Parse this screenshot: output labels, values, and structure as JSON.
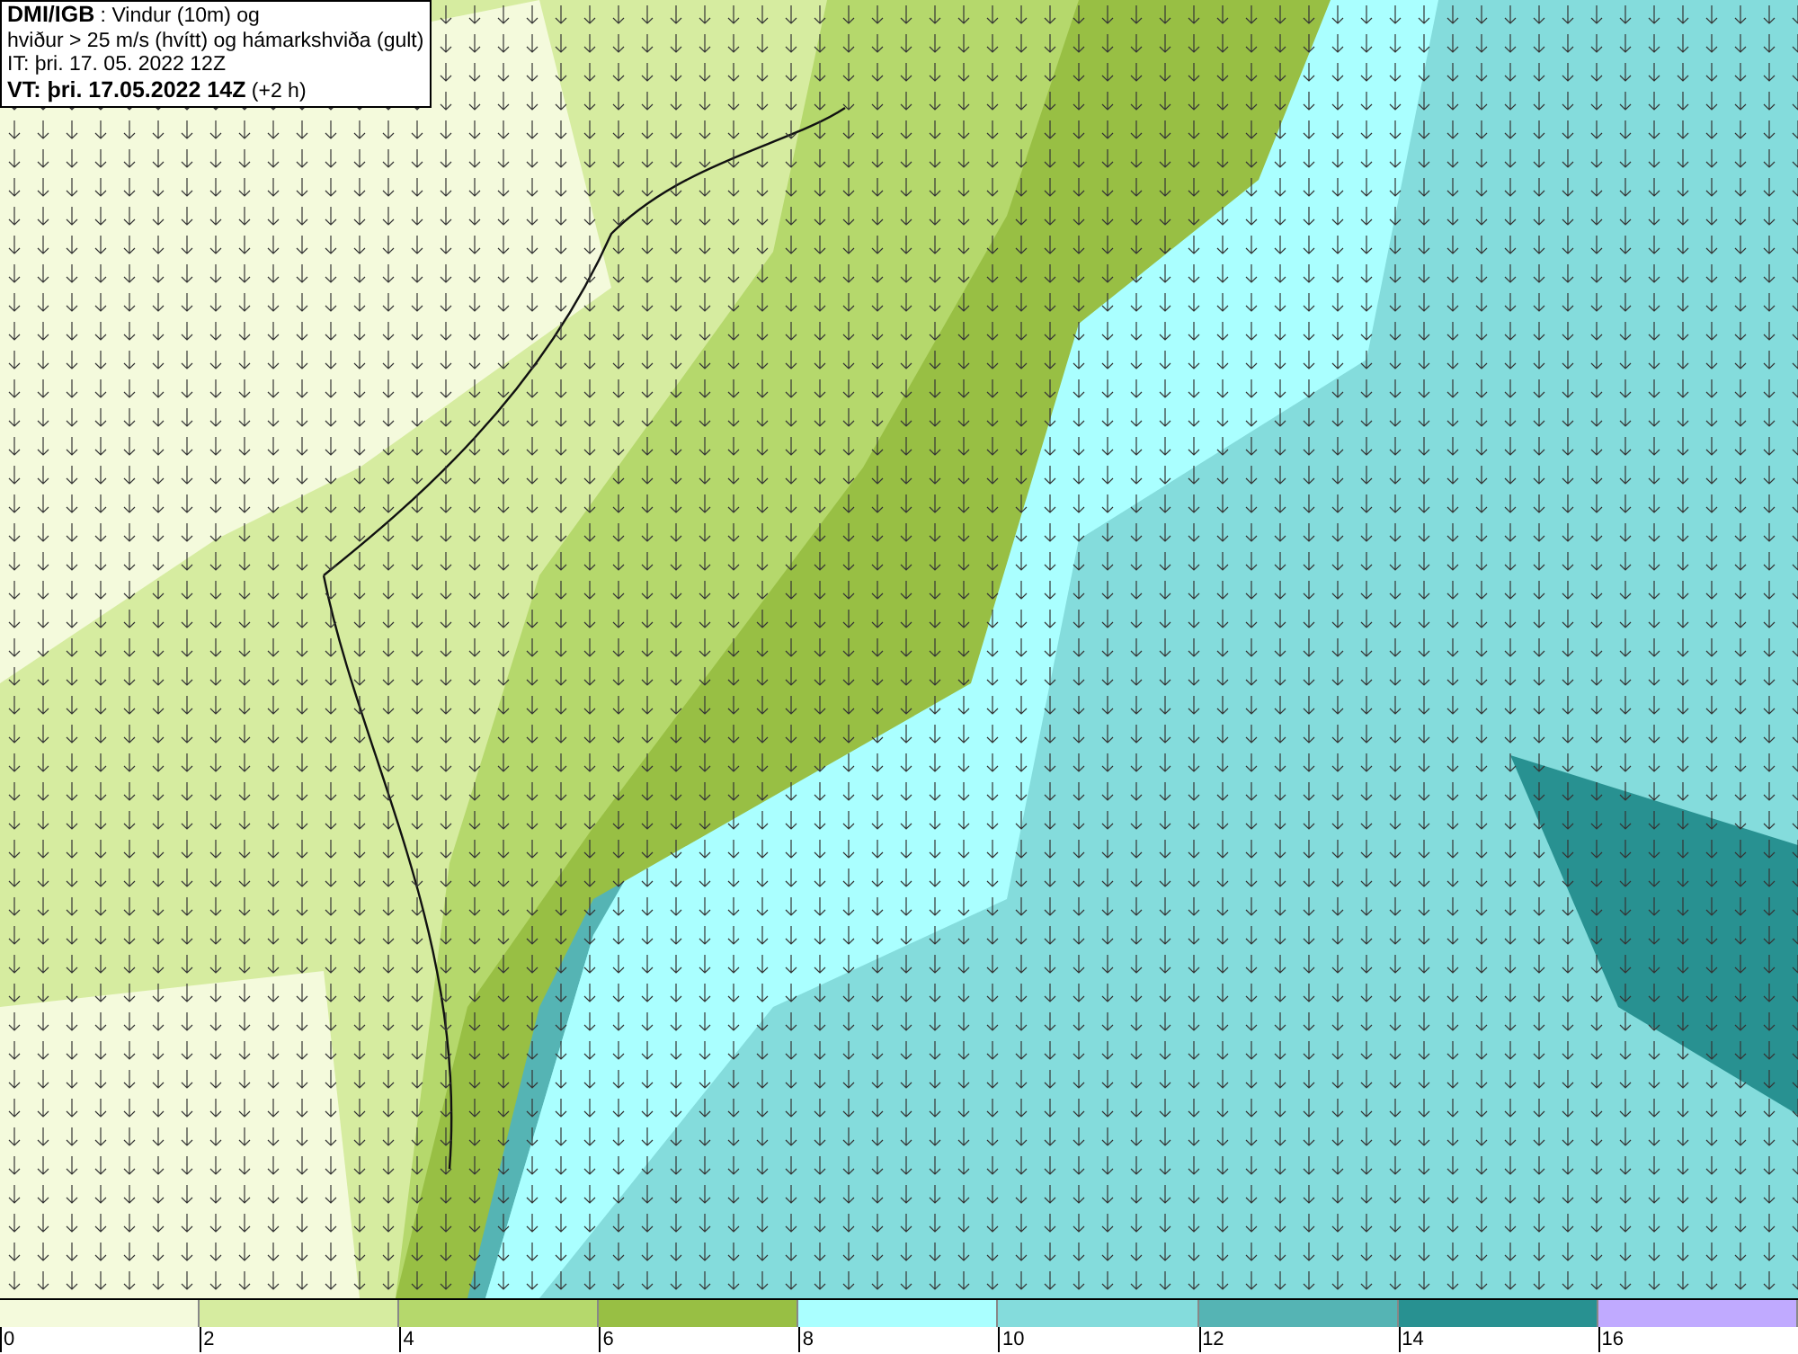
{
  "header": {
    "source": "DMI/IGB",
    "title_rest": " : Vindur (10m) og",
    "line_2": "hviður > 25 m/s (hvítt) og hámarkshviða (gult)",
    "issue_time": "IT: þri. 17. 05. 2022 12Z",
    "valid_label": "VT: þri. 17.05.2022 14Z",
    "valid_offset": " (+2 h)"
  },
  "legend": [
    {
      "label": "0",
      "color": "#f4fadc"
    },
    {
      "label": "2",
      "color": "#d6eca0"
    },
    {
      "label": "4",
      "color": "#b5d86c"
    },
    {
      "label": "6",
      "color": "#98bf44"
    },
    {
      "label": "8",
      "color": "#aaffff"
    },
    {
      "label": "10",
      "color": "#84dcdc"
    },
    {
      "label": "12",
      "color": "#55b4b4"
    },
    {
      "label": "14",
      "color": "#289191"
    },
    {
      "label": "16",
      "color": "#c0aaff"
    }
  ]
}
